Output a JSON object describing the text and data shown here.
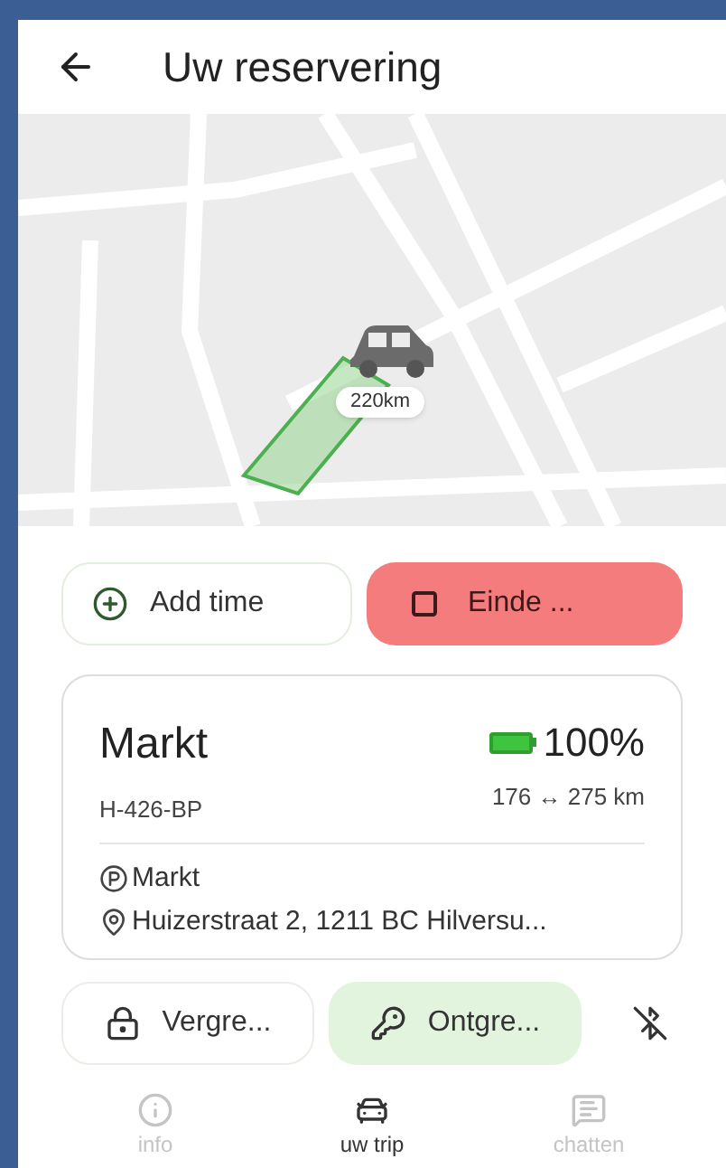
{
  "header": {
    "title": "Uw reservering"
  },
  "map": {
    "vehicle_label": "220km"
  },
  "actions": [
    {
      "label": "Add time",
      "kind": "add"
    },
    {
      "label": "Einde ...",
      "kind": "end"
    }
  ],
  "vehicle": {
    "name": "Markt",
    "plate": "H-426-BP",
    "battery": {
      "level": 1,
      "percent": "100%"
    },
    "range": "176 ↔ 275 km",
    "parking": "Markt",
    "address": "Huizerstraat 2, 1211 BC Hilversu..."
  },
  "lock_actions": [
    {
      "label": "Vergre...",
      "kind": "lock",
      "highlighted": false
    },
    {
      "label": "Ontgre...",
      "kind": "unlock",
      "highlighted": true
    }
  ],
  "bluetooth": {
    "on": false
  },
  "nav": [
    {
      "label": "info",
      "kind": "info",
      "selected": false
    },
    {
      "label": "uw trip",
      "kind": "trip",
      "selected": true
    },
    {
      "label": "chatten",
      "kind": "chat",
      "selected": false
    }
  ]
}
